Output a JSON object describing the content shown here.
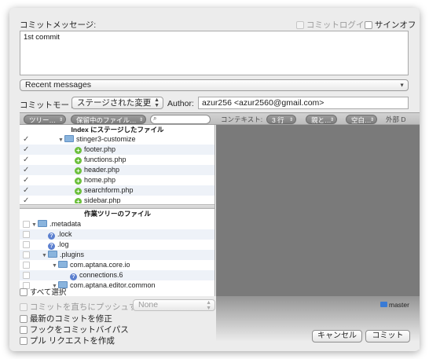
{
  "commit_message": {
    "label": "コミットメッセージ:",
    "value": "1st commit",
    "commit_login_label": "コミットログイン",
    "signoff_label": "サインオフ"
  },
  "recent_messages": {
    "label": "Recent messages"
  },
  "commit_mode": {
    "label": "コミットモード:",
    "value": "ステージされた変更",
    "author_label": "Author:",
    "author_value": "azur256 <azur2560@gmail.com>"
  },
  "toolbar": {
    "tree_view": "ツリー…",
    "filter": "保留中のファイル…",
    "search_placeholder": "",
    "context_label": "コンテキスト:",
    "context_value": "3 行",
    "ignore_value": "親と…",
    "whitespace_value": "空白…",
    "external_label": "外部 D"
  },
  "index_section": {
    "header": "Index にステージしたファイル",
    "items": [
      {
        "name": "stinger3-customize",
        "type": "folder"
      },
      {
        "name": "footer.php",
        "type": "added"
      },
      {
        "name": "functions.php",
        "type": "added"
      },
      {
        "name": "header.php",
        "type": "added"
      },
      {
        "name": "home.php",
        "type": "added"
      },
      {
        "name": "searchform.php",
        "type": "added"
      },
      {
        "name": "sidebar.php",
        "type": "added"
      }
    ]
  },
  "worktree_section": {
    "header": "作業ツリーのファイル",
    "items": [
      {
        "name": ".metadata",
        "type": "folder"
      },
      {
        "name": ".lock",
        "type": "unknown"
      },
      {
        "name": ".log",
        "type": "unknown"
      },
      {
        "name": ".plugins",
        "type": "folder"
      },
      {
        "name": "com.aptana.core.io",
        "type": "folder"
      },
      {
        "name": "connections.6",
        "type": "unknown"
      },
      {
        "name": "com.aptana.editor.common",
        "type": "folder"
      }
    ],
    "select_all": "すべて選択"
  },
  "options": {
    "push_label": "コミットを直ちにプッシュする:",
    "push_target": "None",
    "amend_label": "最新のコミットを修正",
    "bypass_hooks_label": "フックをコミットバイパス",
    "pull_request_label": "プル リクエストを作成",
    "branch": "master"
  },
  "buttons": {
    "cancel": "キャンセル",
    "commit": "コミット"
  },
  "colors": {
    "accent": "#3a7bd5",
    "added": "#6bbf3a",
    "unknown": "#5b7fcf"
  }
}
